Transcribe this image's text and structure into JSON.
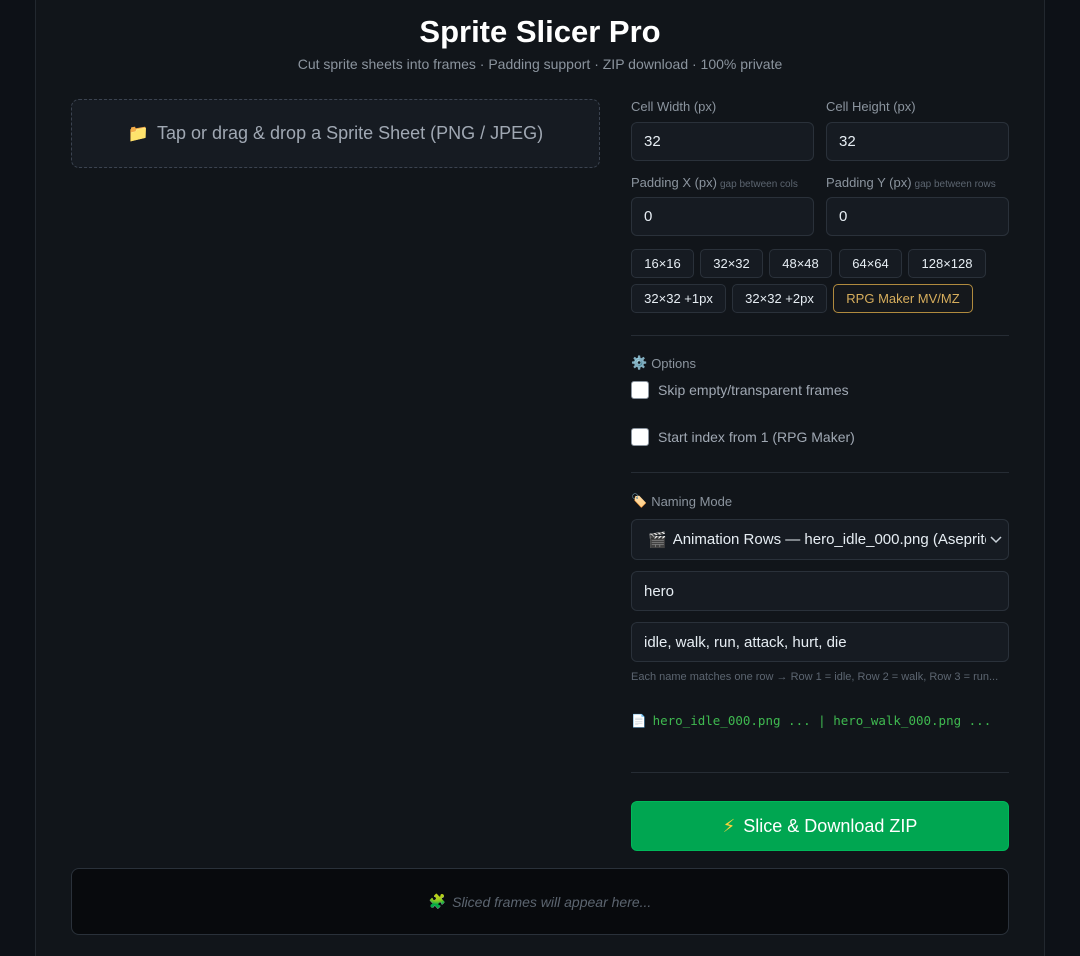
{
  "app": {
    "title": "Sprite Slicer Pro",
    "subtitle": "Cut sprite sheets into frames · Padding support · ZIP download · 100% private"
  },
  "dropzone": {
    "icon": "folder-icon",
    "icon_glyph": "📁",
    "label": "Tap or drag & drop a Sprite Sheet (PNG / JPEG)"
  },
  "fields": {
    "cell_width": {
      "label": "Cell Width (px)",
      "value": "32"
    },
    "cell_height": {
      "label": "Cell Height (px)",
      "value": "32"
    },
    "padding_x": {
      "label": "Padding X (px)",
      "hint": "gap between cols",
      "value": "0"
    },
    "padding_y": {
      "label": "Padding Y (px)",
      "hint": "gap between rows",
      "value": "0"
    }
  },
  "presets": [
    "16×16",
    "32×32",
    "48×48",
    "64×64",
    "128×128",
    "32×32 +1px",
    "32×32 +2px",
    "RPG Maker MV/MZ"
  ],
  "options": {
    "icon_glyph": "⚙️",
    "title": "Options",
    "skip_empty": {
      "label": "Skip empty/transparent frames",
      "checked": false
    },
    "start_index": {
      "label": "Start index from 1 (RPG Maker)",
      "checked": false
    }
  },
  "naming": {
    "icon_glyph": "🏷️",
    "title": "Naming Mode",
    "mode_icon_glyph": "🎬",
    "mode_selected": "Animation Rows — hero_idle_000.png (Aseprite",
    "prefix_value": "hero",
    "rows_value": "idle, walk, run, attack, hurt, die",
    "help": "Each name matches one row → Row 1 = idle, Row 2 = walk, Row 3 = run...",
    "preview_icon_glyph": "📄",
    "preview": "hero_idle_000.png ... | hero_walk_000.png ..."
  },
  "actions": {
    "slice_icon_glyph": "⚡",
    "slice_label": "Slice & Download ZIP"
  },
  "frames": {
    "icon_glyph": "🧩",
    "placeholder": "Sliced frames will appear here..."
  },
  "colors": {
    "background": "#0d1117",
    "accent_green": "#00a651",
    "preset_gold": "#d6ad5c",
    "preview_green": "#3fb950"
  }
}
